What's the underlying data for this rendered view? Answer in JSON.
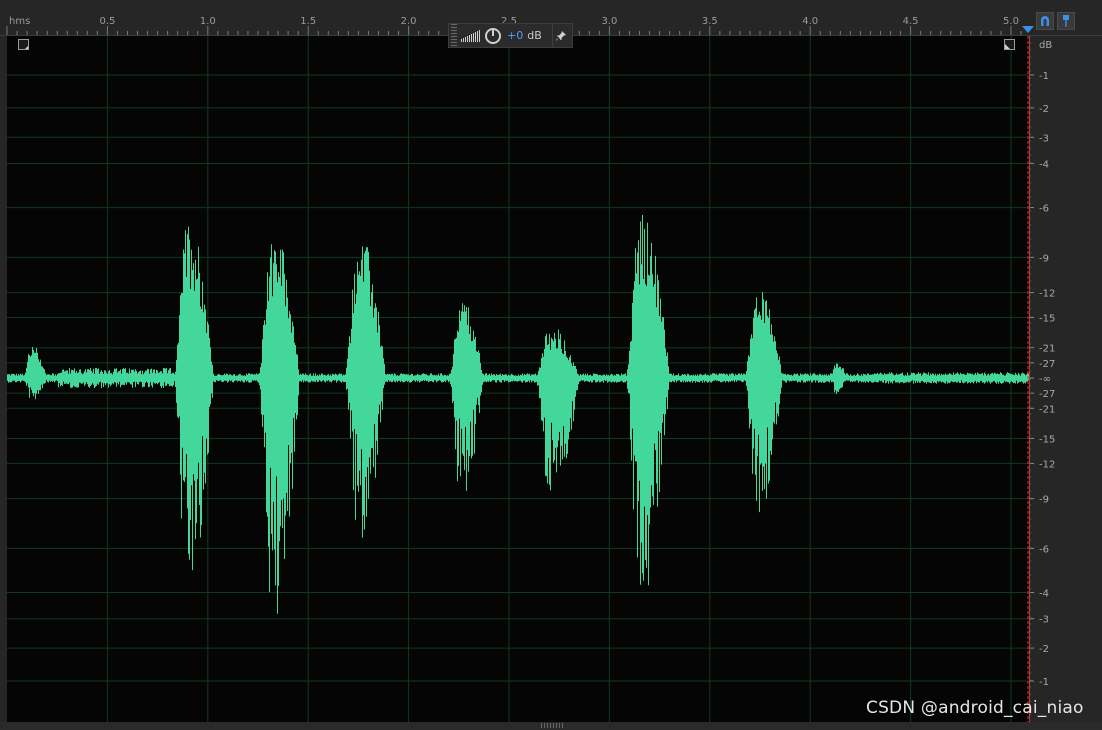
{
  "ruler": {
    "unit_label": "hms",
    "ticks": [
      "0.5",
      "1.0",
      "1.5",
      "2.0",
      "2.5",
      "3.0",
      "3.5",
      "4.0",
      "4.5",
      "5.0"
    ],
    "tools": [
      {
        "name": "snap-magnet-icon"
      },
      {
        "name": "marker-pin-icon"
      }
    ]
  },
  "hud": {
    "volume_value": "+0",
    "volume_unit": "dB",
    "icons": [
      "level-meter-icon",
      "volume-knob-icon",
      "pin-icon"
    ]
  },
  "db_scale": {
    "unit_label": "dB",
    "labels_top": [
      "-1",
      "-2",
      "-3",
      "-4",
      "-6",
      "-9",
      "-12",
      "-15",
      "-21",
      "-27"
    ],
    "center_label": "-∞",
    "labels_bottom": [
      "-27",
      "-21",
      "-15",
      "-12",
      "-9",
      "-6",
      "-4",
      "-3",
      "-2",
      "-1"
    ]
  },
  "waveform": {
    "color": "#44d79b",
    "grid_color": "#0f3a1c",
    "playhead_color": "#d23b3b",
    "duration_seconds": 5.08,
    "segments": [
      {
        "start": 0.08,
        "end": 0.25,
        "peak_pos": 0.12,
        "peak_neg": 0.08
      },
      {
        "start": 0.83,
        "end": 1.12,
        "peak_pos": 0.57,
        "peak_neg": 0.76
      },
      {
        "start": 1.25,
        "end": 1.55,
        "peak_pos": 0.53,
        "peak_neg": 0.87
      },
      {
        "start": 1.68,
        "end": 1.98,
        "peak_pos": 0.5,
        "peak_neg": 0.57
      },
      {
        "start": 2.2,
        "end": 2.45,
        "peak_pos": 0.28,
        "peak_neg": 0.42
      },
      {
        "start": 2.63,
        "end": 2.95,
        "peak_pos": 0.18,
        "peak_neg": 0.44
      },
      {
        "start": 3.08,
        "end": 3.4,
        "peak_pos": 0.59,
        "peak_neg": 0.78
      },
      {
        "start": 3.67,
        "end": 3.95,
        "peak_pos": 0.31,
        "peak_neg": 0.48
      },
      {
        "start": 4.1,
        "end": 4.22,
        "peak_pos": 0.06,
        "peak_neg": 0.06
      }
    ]
  },
  "watermark": "CSDN @android_cai_niao"
}
